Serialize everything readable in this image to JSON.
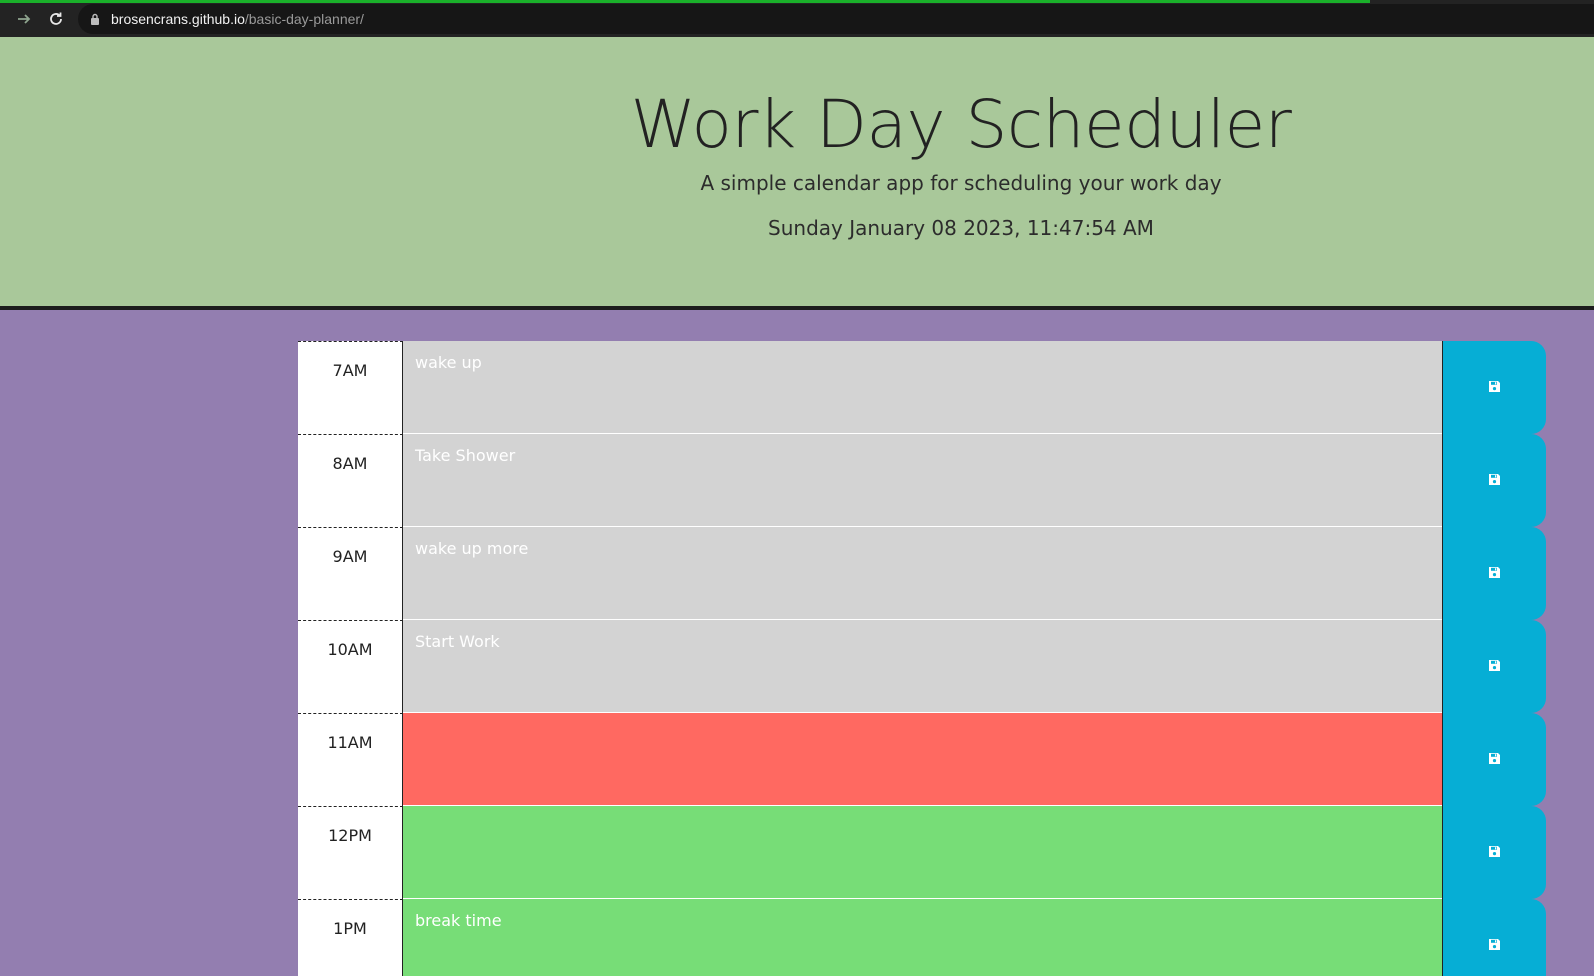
{
  "browser": {
    "url_host": "brosencrans.github.io",
    "url_path": "/basic-day-planner/"
  },
  "header": {
    "title": "Work Day Scheduler",
    "subtitle": "A simple calendar app for scheduling your work day",
    "datetime": "Sunday January 08 2023, 11:47:54 AM"
  },
  "colors": {
    "header_bg": "#a9c89a",
    "page_bg": "#937eb0",
    "past": "#d3d3d3",
    "present": "#ff6961",
    "future": "#77dd77",
    "save_button": "#06aed5"
  },
  "planner": {
    "hours": [
      {
        "label": "7AM",
        "text": "wake up",
        "state": "past"
      },
      {
        "label": "8AM",
        "text": "Take Shower",
        "state": "past"
      },
      {
        "label": "9AM",
        "text": "wake up more",
        "state": "past"
      },
      {
        "label": "10AM",
        "text": "Start Work",
        "state": "past"
      },
      {
        "label": "11AM",
        "text": "",
        "state": "present"
      },
      {
        "label": "12PM",
        "text": "",
        "state": "future"
      },
      {
        "label": "1PM",
        "text": "break time",
        "state": "future"
      }
    ],
    "save_icon": "floppy-disk-icon"
  }
}
